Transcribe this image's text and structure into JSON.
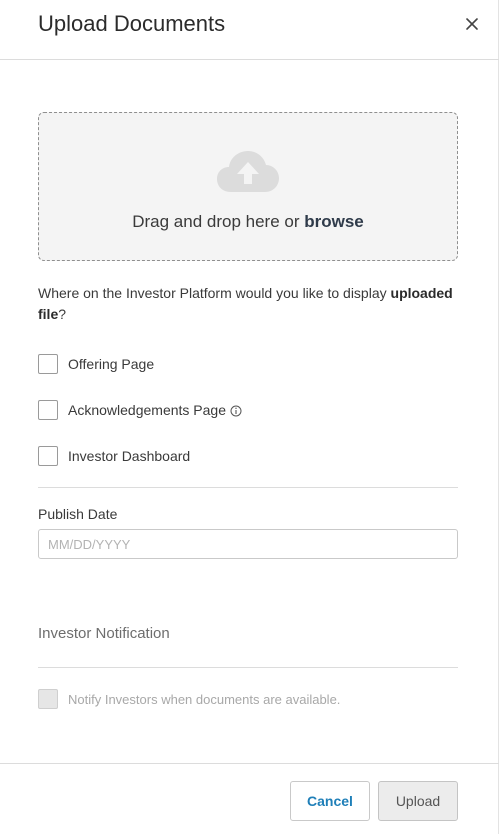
{
  "modal": {
    "title": "Upload Documents"
  },
  "dropzone": {
    "text": "Drag and drop here or ",
    "browse_label": "browse",
    "icon": "cloud-upload-icon"
  },
  "display": {
    "question_prefix": "Where on the Investor Platform would you like to display ",
    "question_bold": "uploaded file",
    "question_suffix": "?",
    "options": [
      {
        "label": "Offering Page",
        "checked": false,
        "has_info": false
      },
      {
        "label": "Acknowledgements Page",
        "checked": false,
        "has_info": true
      },
      {
        "label": "Investor Dashboard",
        "checked": false,
        "has_info": false
      }
    ]
  },
  "publish": {
    "label": "Publish Date",
    "placeholder": "MM/DD/YYYY",
    "value": ""
  },
  "notification": {
    "title": "Investor Notification",
    "checkbox_label": "Notify Investors when documents are available.",
    "checked": false,
    "disabled": true
  },
  "footer": {
    "cancel_label": "Cancel",
    "upload_label": "Upload"
  },
  "colors": {
    "accent": "#1f7fb8",
    "cloud": "#dcdcdc"
  }
}
